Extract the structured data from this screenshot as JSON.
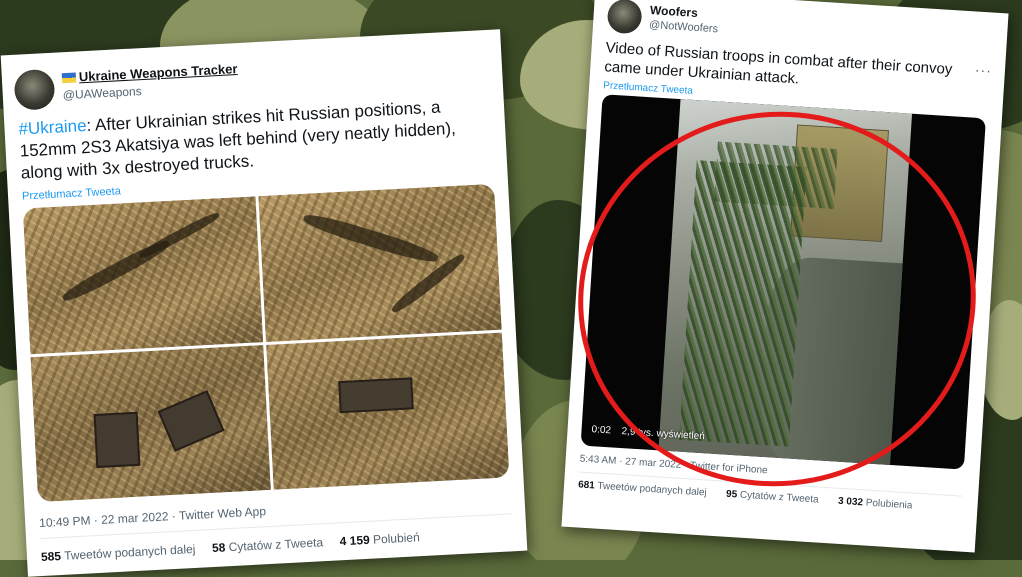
{
  "left_tweet": {
    "author_name": "Ukraine Weapons Tracker",
    "author_handle": "@UAWeapons",
    "hashtag": "#Ukraine",
    "text": ": After Ukrainian strikes hit Russian positions, a 152mm 2S3 Akatsiya was left behind (very neatly hidden), along with 3x destroyed trucks.",
    "translate_label": "Przetłumacz Tweeta",
    "timestamp": "10:49 PM · 22 mar 2022 · Twitter Web App",
    "stats": [
      {
        "count": "585",
        "label": "Tweetów podanych dalej"
      },
      {
        "count": "58",
        "label": "Cytatów z Tweeta"
      },
      {
        "count": "4 159",
        "label": "Polubień"
      }
    ]
  },
  "right_tweet": {
    "author_name": "Woofers",
    "author_handle": "@NotWoofers",
    "text": "Video of Russian troops in combat after their convoy came under Ukrainian attack.",
    "translate_label": "Przetłumacz Tweeta",
    "video_time": "0:02",
    "video_views": "2,9 tys. wyświetleń",
    "timestamp": "5:43 AM · 27 mar 2022 · Twitter for iPhone",
    "menu": "···",
    "stats": [
      {
        "count": "681",
        "label": "Tweetów podanych dalej"
      },
      {
        "count": "95",
        "label": "Cytatów z Tweeta"
      },
      {
        "count": "3 032",
        "label": "Polubienia"
      }
    ]
  },
  "colors": {
    "link_blue": "#1d9bf0",
    "highlight_red": "#e31b1b",
    "camo_greens": [
      "#4d5a30",
      "#2c3a1e",
      "#7a8650",
      "#a7ad7a",
      "#1f2914"
    ]
  },
  "icons": {
    "flag": "ukraine-flag-icon",
    "menu": "more-options-icon"
  }
}
